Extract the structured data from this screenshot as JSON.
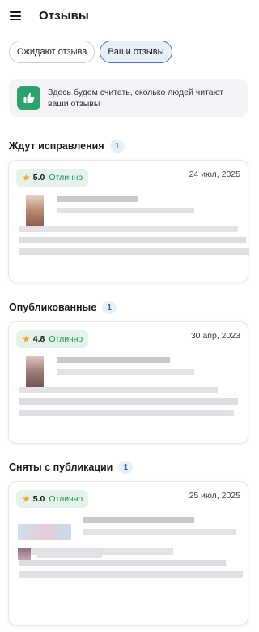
{
  "header": {
    "title": "Отзывы"
  },
  "tabs": [
    {
      "label": "Ожидают отзыва",
      "active": false
    },
    {
      "label": "Ваши отзывы",
      "active": true
    }
  ],
  "info": {
    "text": "Здесь будем считать, сколько людей читают ваши отзывы",
    "icon": "thumbs-up-icon",
    "icon_color": "#2aa26a"
  },
  "sections": [
    {
      "title": "Ждут исправления",
      "count": "1",
      "card": {
        "rating": "5.0",
        "rating_label": "Отлично",
        "date": "24 июл, 2025"
      }
    },
    {
      "title": "Опубликованные",
      "count": "1",
      "card": {
        "rating": "4.8",
        "rating_label": "Отлично",
        "date": "30 апр, 2023"
      }
    },
    {
      "title": "Сняты с публикации",
      "count": "1",
      "card": {
        "rating": "5.0",
        "rating_label": "Отлично",
        "date": "25 июл, 2025"
      }
    }
  ],
  "colors": {
    "accent": "#4a6fd6",
    "success": "#2aa26a",
    "star": "#f5a623"
  }
}
